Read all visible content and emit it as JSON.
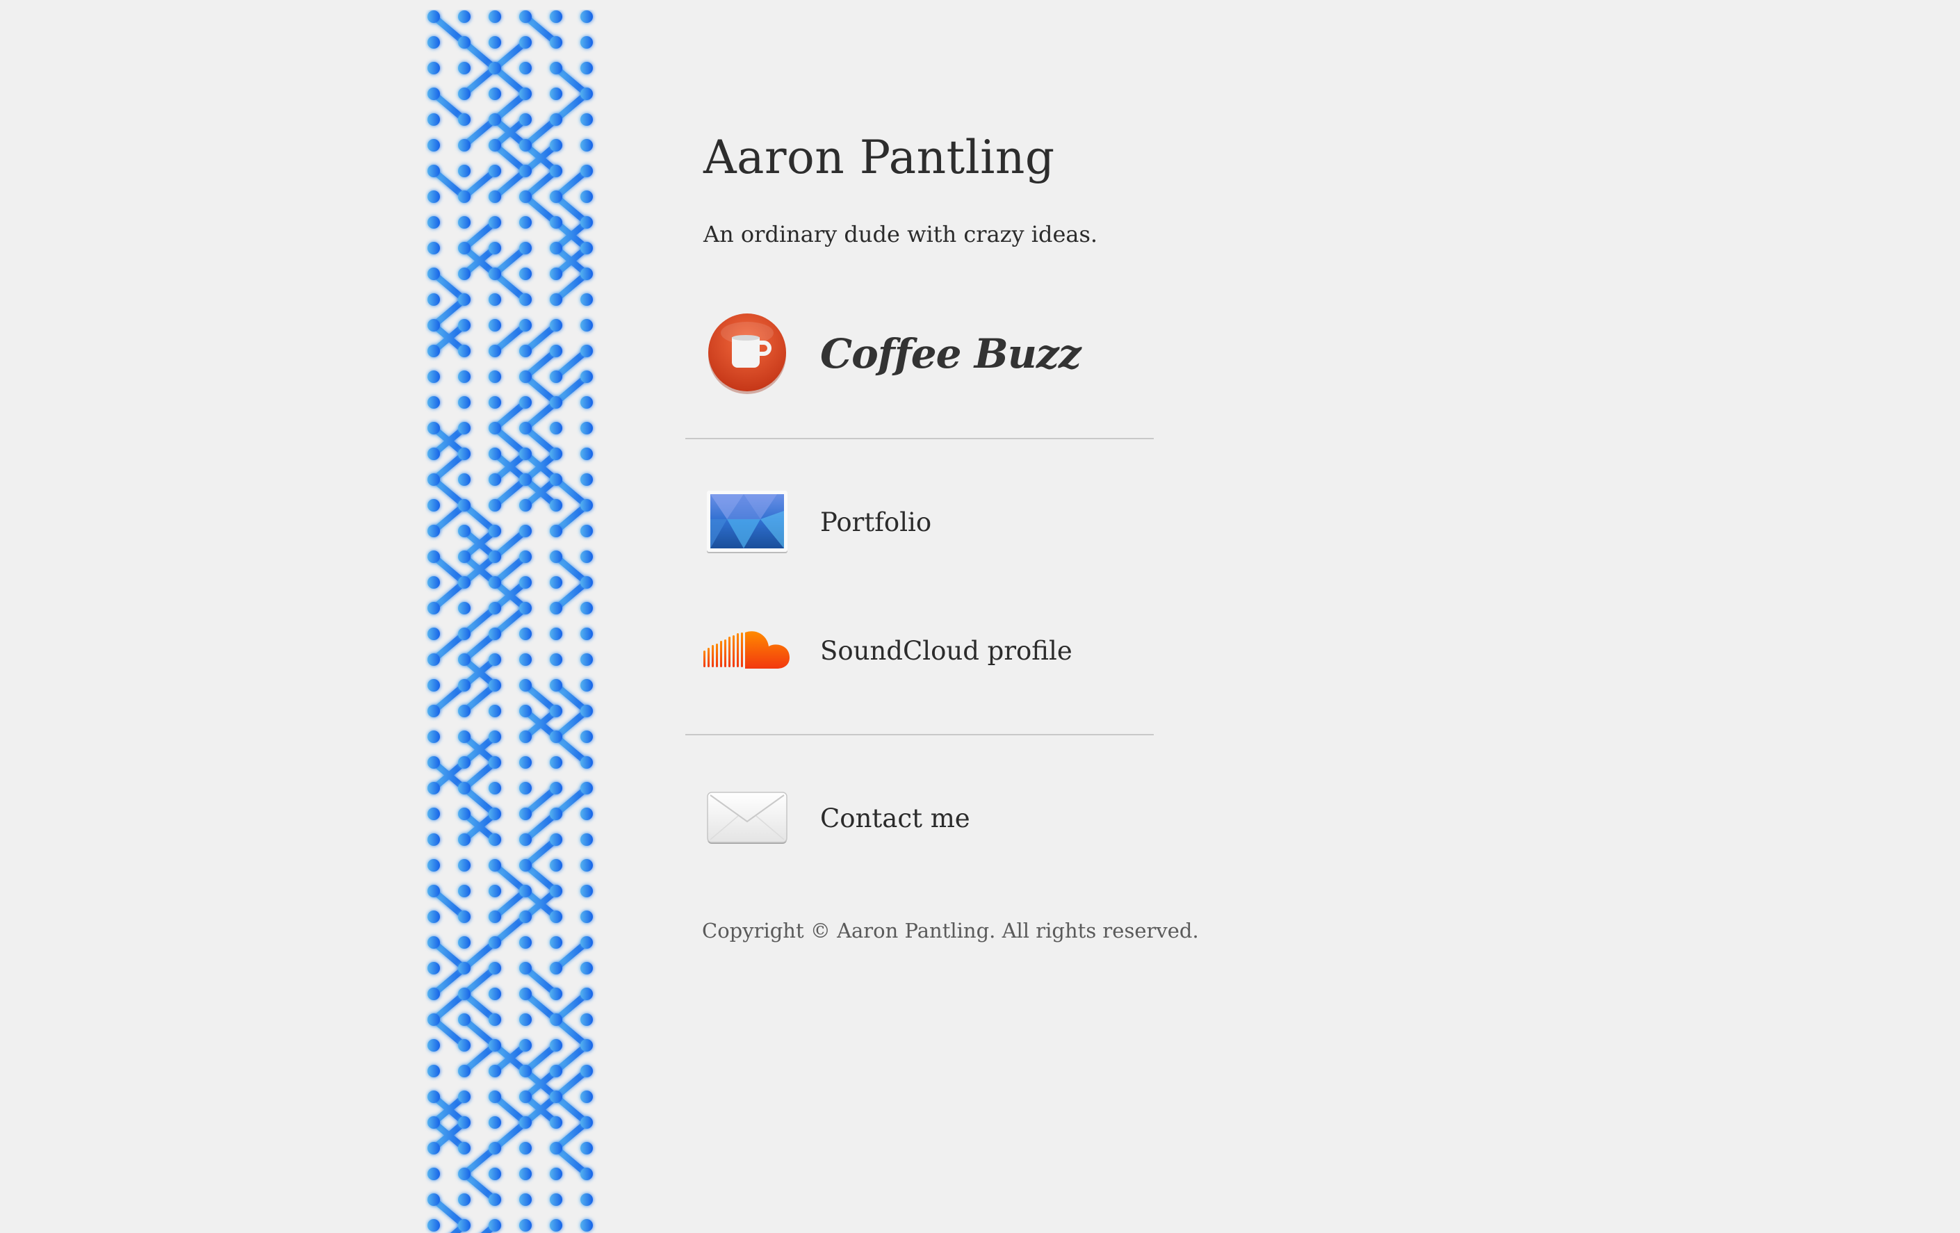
{
  "header": {
    "name": "Aaron Pantling",
    "tagline": "An ordinary dude with crazy ideas."
  },
  "links": {
    "coffee_buzz": {
      "label": "Coffee Buzz",
      "icon": "coffee-cup-icon"
    },
    "portfolio": {
      "label": "Portfolio",
      "icon": "portfolio-image-icon"
    },
    "soundcloud": {
      "label": "SoundCloud profile",
      "icon": "soundcloud-icon"
    },
    "contact": {
      "label": "Contact me",
      "icon": "envelope-icon"
    }
  },
  "footer": {
    "copyright": "Copyright © Aaron Pantling. All rights reserved."
  },
  "colors": {
    "background": "#f0f0f0",
    "pattern_light": "#4aa8ee",
    "pattern_dark": "#1a66e6",
    "coffee_red": "#e0452a",
    "soundcloud_orange": "#ff5500"
  }
}
